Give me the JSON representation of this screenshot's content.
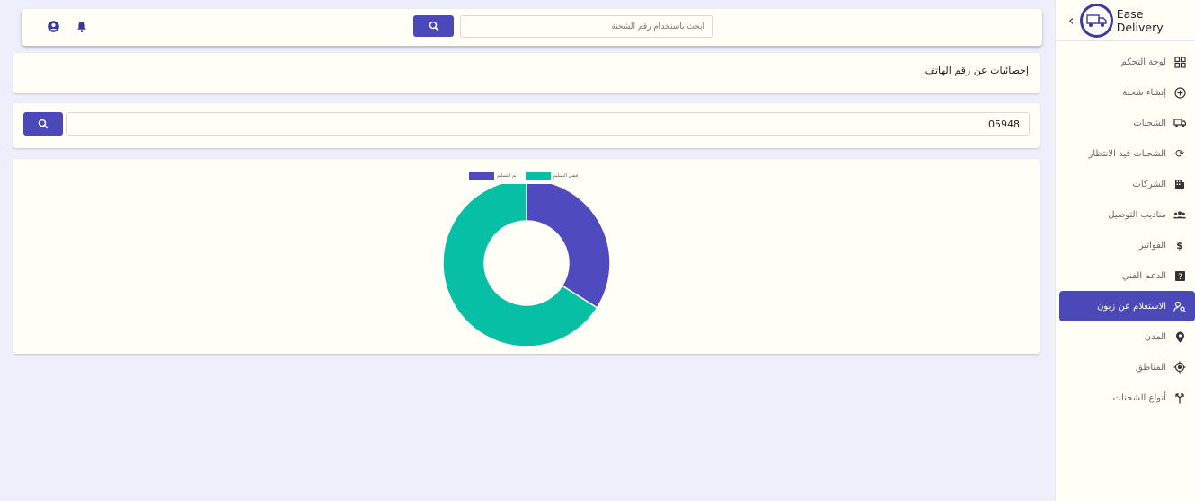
{
  "sidebar": {
    "brand": "Ease Delivery",
    "logo_text": "EASE DELIVERY",
    "items": [
      {
        "label": "لوحة التحكم",
        "icon": "dashboard-icon"
      },
      {
        "label": "إنشاء شحنة",
        "icon": "add-circle-icon"
      },
      {
        "label": "الشحنات",
        "icon": "truck-icon"
      },
      {
        "label": "الشحنات قيد الانتظار",
        "icon": "refresh-icon"
      },
      {
        "label": "الشركات",
        "icon": "building-icon"
      },
      {
        "label": "مناديب التوصيل",
        "icon": "people-icon"
      },
      {
        "label": "الفواتير",
        "icon": "invoice-icon"
      },
      {
        "label": "الدعم الفني",
        "icon": "support-icon"
      },
      {
        "label": "الاستعلام عن زبون",
        "icon": "person-search-icon",
        "active": true
      },
      {
        "label": "المدن",
        "icon": "location-pin-icon"
      },
      {
        "label": "المناطق",
        "icon": "target-icon"
      },
      {
        "label": "أنواع الشحنات",
        "icon": "split-arrow-icon"
      }
    ]
  },
  "topbar": {
    "search_placeholder": "ابحث باستخدام رقم الشحنة",
    "icons": [
      "account-circle-icon",
      "bell-icon",
      "search-icon"
    ]
  },
  "page": {
    "title": "إحصائيات عن رقم الهاتف",
    "phone_value": "05948"
  },
  "chart_data": {
    "type": "pie",
    "donut": true,
    "labels": [
      "تم التسليم",
      "فشل التسليم"
    ],
    "values": [
      34,
      66
    ],
    "colors": [
      "#4f4bbf",
      "#07bfa5"
    ],
    "legend_position": "top"
  }
}
